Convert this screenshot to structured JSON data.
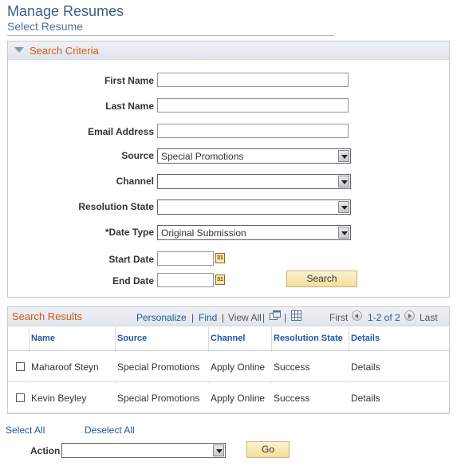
{
  "page": {
    "title": "Manage Resumes",
    "subtitle": "Select Resume"
  },
  "search_criteria": {
    "title": "Search Criteria",
    "first_name": {
      "label": "First Name",
      "value": ""
    },
    "last_name": {
      "label": "Last Name",
      "value": ""
    },
    "email": {
      "label": "Email Address",
      "value": ""
    },
    "source": {
      "label": "Source",
      "value": "Special Promotions"
    },
    "channel": {
      "label": "Channel",
      "value": ""
    },
    "resolution_state": {
      "label": "Resolution State",
      "value": ""
    },
    "date_type": {
      "label": "*Date Type",
      "value": "Original Submission"
    },
    "start_date": {
      "label": "Start Date",
      "value": ""
    },
    "end_date": {
      "label": "End Date",
      "value": ""
    },
    "calendar_icon_text": "31",
    "search_label": "Search"
  },
  "results": {
    "title": "Search Results",
    "personalize": "Personalize",
    "find": "Find",
    "view_all": "View All",
    "sep": "|",
    "first": "First",
    "range": "1-2 of 2",
    "last": "Last",
    "columns": [
      "Name",
      "Source",
      "Channel",
      "Resolution State",
      "Details"
    ],
    "rows": [
      {
        "name": "Maharoof Steyn",
        "source": "Special Promotions",
        "channel": "Apply Online",
        "state": "Success",
        "details": "Details"
      },
      {
        "name": "Kevin Beyley",
        "source": "Special Promotions",
        "channel": "Apply Online",
        "state": "Success",
        "details": "Details"
      }
    ]
  },
  "footer": {
    "select_all": "Select All",
    "deselect_all": "Deselect All",
    "action_label": "Action",
    "action_value": "",
    "go_label": "Go"
  },
  "colors": {
    "title": "#3d5e85",
    "section_title": "#d0571e",
    "link": "#2255a4",
    "button": "#f6dd98"
  },
  "icons": [
    "collapse-arrow-icon",
    "calendar-icon",
    "new-window-icon",
    "grid-download-icon",
    "previous-icon",
    "next-icon",
    "dropdown-arrow-icon"
  ]
}
